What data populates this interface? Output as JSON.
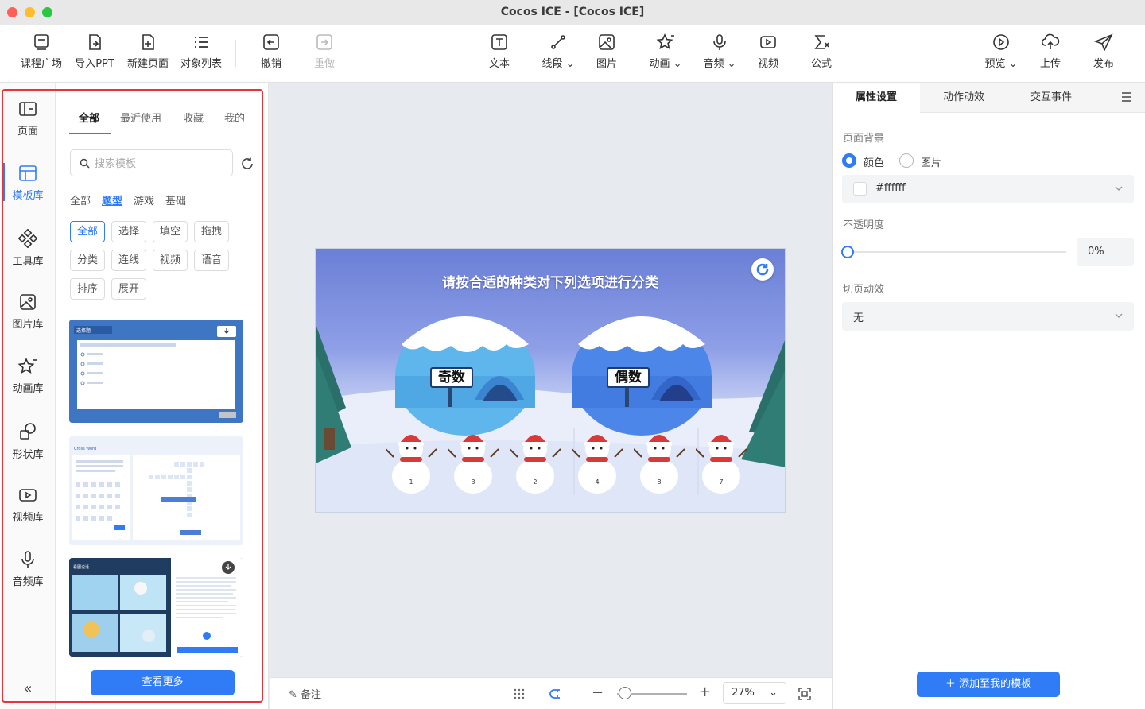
{
  "window": {
    "title": "Cocos ICE - [Cocos ICE]"
  },
  "toolbar": {
    "left": [
      {
        "id": "course-plaza",
        "label": "课程广场",
        "icon": "course-plaza-icon"
      },
      {
        "id": "import-ppt",
        "label": "导入PPT",
        "icon": "import-icon"
      },
      {
        "id": "new-page",
        "label": "新建页面",
        "icon": "new-page-icon"
      },
      {
        "id": "object-list",
        "label": "对象列表",
        "icon": "list-icon"
      },
      {
        "id": "undo",
        "label": "撤销",
        "icon": "undo-icon"
      },
      {
        "id": "redo",
        "label": "重做",
        "icon": "redo-icon",
        "disabled": true
      }
    ],
    "center": [
      {
        "id": "text",
        "label": "文本",
        "icon": "text-icon"
      },
      {
        "id": "line",
        "label": "线段",
        "icon": "line-icon",
        "dropdown": true
      },
      {
        "id": "image",
        "label": "图片",
        "icon": "image-icon"
      },
      {
        "id": "animation",
        "label": "动画",
        "icon": "star-icon",
        "dropdown": true
      },
      {
        "id": "audio",
        "label": "音频",
        "icon": "microphone-icon",
        "dropdown": true
      },
      {
        "id": "video",
        "label": "视频",
        "icon": "video-icon"
      },
      {
        "id": "formula",
        "label": "公式",
        "icon": "formula-icon"
      }
    ],
    "right": [
      {
        "id": "preview",
        "label": "预览",
        "icon": "play-icon",
        "dropdown": true
      },
      {
        "id": "upload",
        "label": "上传",
        "icon": "upload-icon"
      },
      {
        "id": "publish",
        "label": "发布",
        "icon": "send-icon"
      }
    ]
  },
  "rail": {
    "items": [
      {
        "id": "page",
        "label": "页面",
        "icon": "page-icon"
      },
      {
        "id": "template",
        "label": "模板库",
        "icon": "template-icon",
        "active": true
      },
      {
        "id": "tools",
        "label": "工具库",
        "icon": "tools-icon"
      },
      {
        "id": "pictures",
        "label": "图片库",
        "icon": "picture-icon"
      },
      {
        "id": "animations",
        "label": "动画库",
        "icon": "animation-star-icon"
      },
      {
        "id": "shapes",
        "label": "形状库",
        "icon": "shapes-icon"
      },
      {
        "id": "videos",
        "label": "视频库",
        "icon": "video-library-icon"
      },
      {
        "id": "audios",
        "label": "音频库",
        "icon": "audio-library-icon"
      }
    ],
    "collapse_glyph": "«"
  },
  "template_panel": {
    "tabs": [
      "全部",
      "最近使用",
      "收藏",
      "我的"
    ],
    "active_tab": "全部",
    "search": {
      "placeholder": "搜索模板",
      "value": ""
    },
    "categories": [
      "全部",
      "题型",
      "游戏",
      "基础"
    ],
    "active_category": "题型",
    "chips": [
      "全部",
      "选择",
      "填空",
      "拖拽",
      "分类",
      "连线",
      "视频",
      "语音",
      "排序",
      "展开"
    ],
    "active_chip": "全部",
    "cards": [
      {
        "id": "choice-template",
        "label": "选择题"
      },
      {
        "id": "crossword-template",
        "label": "Cross Word"
      },
      {
        "id": "image-template",
        "label": "看图说话"
      }
    ],
    "more_button": "查看更多"
  },
  "stage": {
    "title": "请按合适的种类对下列选项进行分类",
    "groups": [
      {
        "label": "奇数"
      },
      {
        "label": "偶数"
      }
    ],
    "items": [
      "1",
      "3",
      "2",
      "4",
      "8",
      "7"
    ]
  },
  "canvas_footer": {
    "note_label": "备注",
    "zoom": "27%"
  },
  "right_panel": {
    "tabs": [
      "属性设置",
      "动作动效",
      "交互事件"
    ],
    "active_tab": "属性设置",
    "background_label": "页面背景",
    "background_options": [
      "颜色",
      "图片"
    ],
    "background_selected": "颜色",
    "color_value": "#ffffff",
    "opacity_label": "不透明度",
    "opacity_value": "0%",
    "transition_label": "切页动效",
    "transition_value": "无",
    "add_template_button": "添加至我的模板"
  },
  "colors": {
    "accent": "#2f7cf6",
    "highlight_outline": "#e8333a"
  }
}
